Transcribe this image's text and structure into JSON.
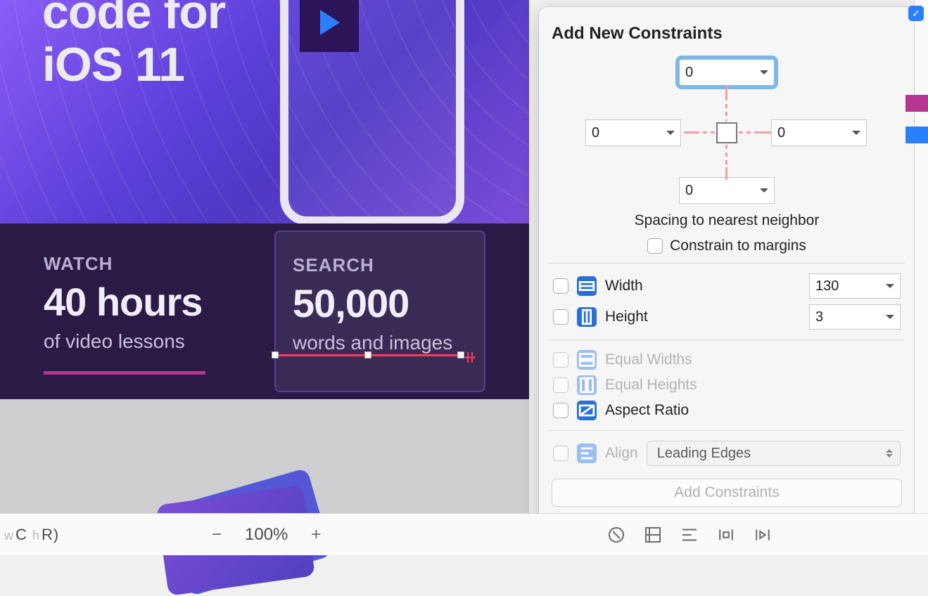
{
  "canvas": {
    "hero_text_line1": "code for",
    "hero_text_line2": "iOS 11",
    "watch": {
      "title": "WATCH",
      "value": "40 hours",
      "sub": "of video lessons"
    },
    "search": {
      "title": "SEARCH",
      "value": "50,000",
      "sub": "words and images"
    }
  },
  "bottombar": {
    "view_hint_prefix_w": "w",
    "view_hint_C": "C",
    "view_hint_prefix_h": "h",
    "view_hint_R": "R)",
    "zoom_minus": "−",
    "zoom_level": "100%",
    "zoom_plus": "+"
  },
  "popover": {
    "title": "Add New Constraints",
    "top": "0",
    "left": "0",
    "right": "0",
    "bottom": "0",
    "spacing_label": "Spacing to nearest neighbor",
    "constrain_margins": "Constrain to margins",
    "width_label": "Width",
    "width_value": "130",
    "height_label": "Height",
    "height_value": "3",
    "equal_widths": "Equal Widths",
    "equal_heights": "Equal Heights",
    "aspect_ratio": "Aspect Ratio",
    "align_label": "Align",
    "align_value": "Leading Edges",
    "add_button": "Add Constraints"
  }
}
